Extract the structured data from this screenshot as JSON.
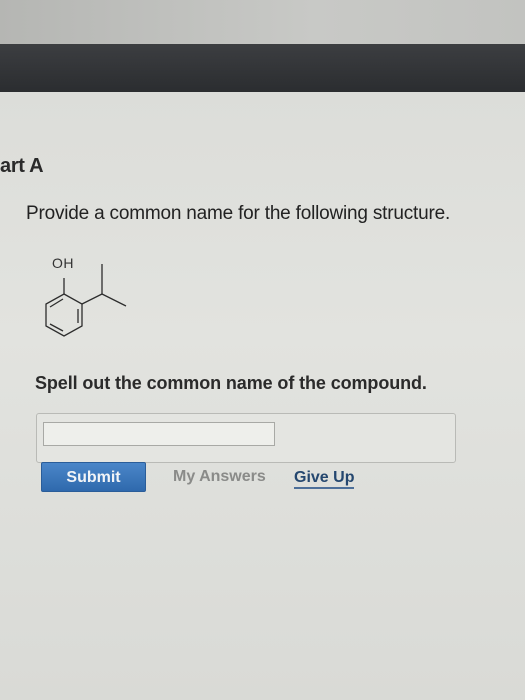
{
  "part": {
    "title": "art A"
  },
  "question": {
    "prompt": "Provide a common name for the following structure."
  },
  "structure": {
    "substituent_label": "OH"
  },
  "answer": {
    "instruction": "Spell out the common name of the compound.",
    "input_value": ""
  },
  "actions": {
    "submit_label": "Submit",
    "my_answers_label": "My Answers",
    "give_up_label": "Give Up"
  },
  "colors": {
    "submit_bg": "#3a77bd",
    "give_up_link": "#24476f",
    "disabled_link": "#8a8b89"
  }
}
